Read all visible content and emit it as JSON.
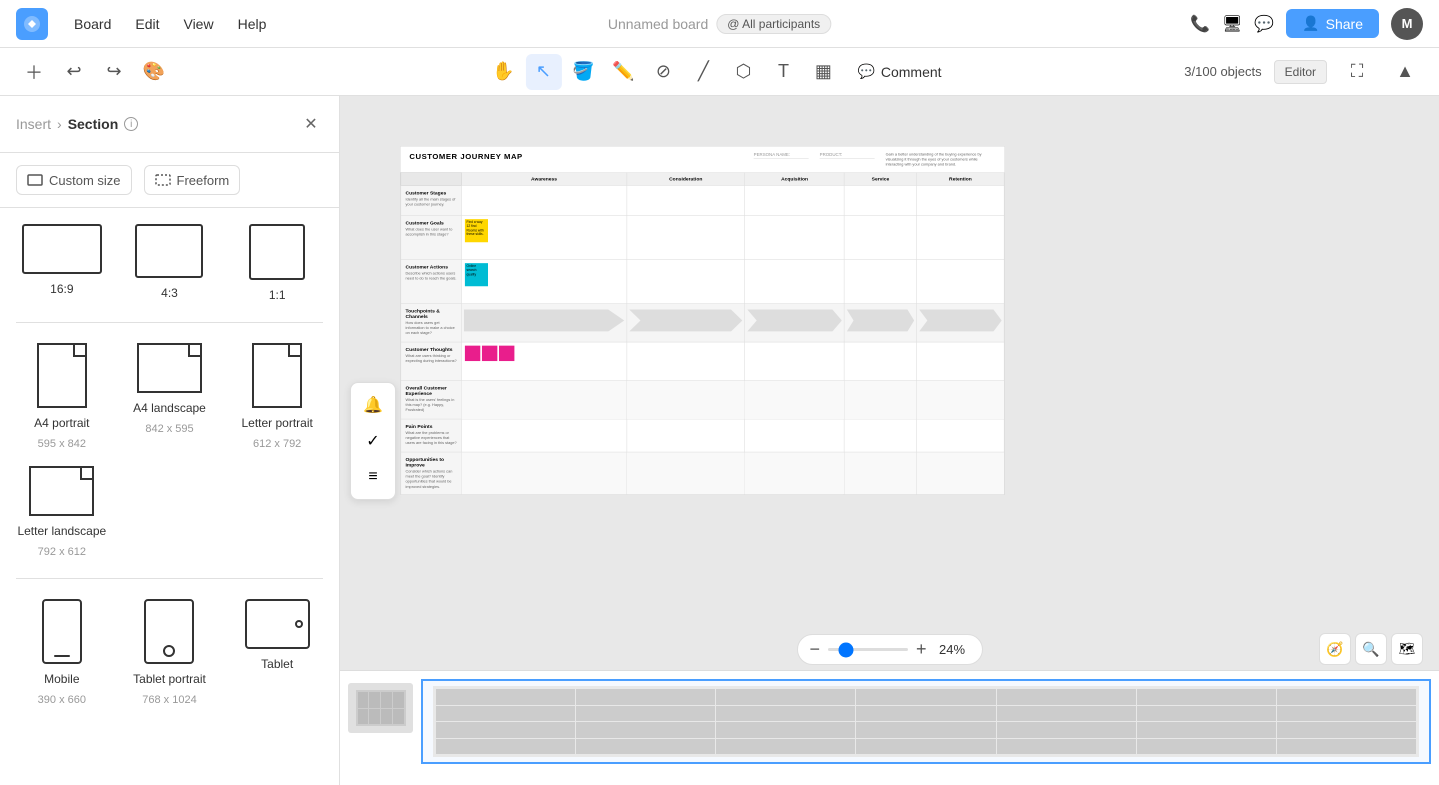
{
  "app": {
    "logo": "M",
    "menu": [
      "Board",
      "Edit",
      "View",
      "Help"
    ],
    "title": "Unnamed board",
    "participants": "@ All participants",
    "objectCount": "3/100 objects",
    "editorLabel": "Editor",
    "shareLabel": "Share"
  },
  "toolbar": {
    "tools": [
      "hand",
      "cursor",
      "fill",
      "pen",
      "eraser",
      "line",
      "shapes",
      "text",
      "sticky"
    ],
    "commentLabel": "Comment",
    "zoomLevel": "24%"
  },
  "leftPanel": {
    "breadcrumb": [
      "Insert",
      "Section"
    ],
    "options": [
      "Custom size",
      "Freeform"
    ],
    "shapes": [
      {
        "label": "16:9",
        "sub": ""
      },
      {
        "label": "4:3",
        "sub": ""
      },
      {
        "label": "1:1",
        "sub": ""
      },
      {
        "label": "A4 portrait",
        "sub": "595 x 842"
      },
      {
        "label": "A4 landscape",
        "sub": "842 x 595"
      },
      {
        "label": "Letter portrait",
        "sub": "612 x 792"
      },
      {
        "label": "Letter landscape",
        "sub": "792 x 612"
      },
      {
        "label": "Mobile",
        "sub": "390 x 660"
      },
      {
        "label": "Tablet portrait",
        "sub": "768 x 1024"
      },
      {
        "label": "Tablet",
        "sub": ""
      }
    ]
  },
  "journeyMap": {
    "title": "CUSTOMER JOURNEY MAP",
    "personaLabel": "PERSONA NAME:",
    "productLabel": "PRODUCT:",
    "description": "Gain a better understanding of the buying experience by visualizing it through the eyes of your customers while interacting with your company and brand.",
    "stages": [
      "Awareness",
      "Consideration",
      "Acquisition",
      "Service",
      "Retention"
    ],
    "rows": [
      {
        "id": "customer-stages",
        "title": "Customer Stages",
        "desc": "Identify all the main stages of your customer journey."
      },
      {
        "id": "customer-goals",
        "title": "Customer Goals",
        "desc": "What does the user want to accomplish in this stage?"
      },
      {
        "id": "customer-actions",
        "title": "Customer Actions",
        "desc": "Describe which actions users need to do to reach the goals."
      },
      {
        "id": "touchpoints",
        "title": "Touchpoints & Channels",
        "desc": "How does users get information to make a choice on each stage?"
      },
      {
        "id": "customer-thoughts",
        "title": "Customer Thoughts",
        "desc": "What are users thinking or expecting during interactions?"
      },
      {
        "id": "overall-experience",
        "title": "Overall Customer Experience",
        "desc": "What is the users' feelings in this map? (e.g. Happy, Frustrated)"
      },
      {
        "id": "pain-points",
        "title": "Pain Points",
        "desc": "What are the problems or negative experiences that users are facing in this stage?"
      },
      {
        "id": "opportunities",
        "title": "Opportunities to Improve",
        "desc": "Consider which actions can meet the goal? Identify opportunities that would be improved strategies."
      }
    ]
  },
  "sideIcons": [
    "bell",
    "check",
    "list"
  ],
  "zoom": {
    "level": "24%",
    "minus": "−",
    "plus": "+"
  }
}
